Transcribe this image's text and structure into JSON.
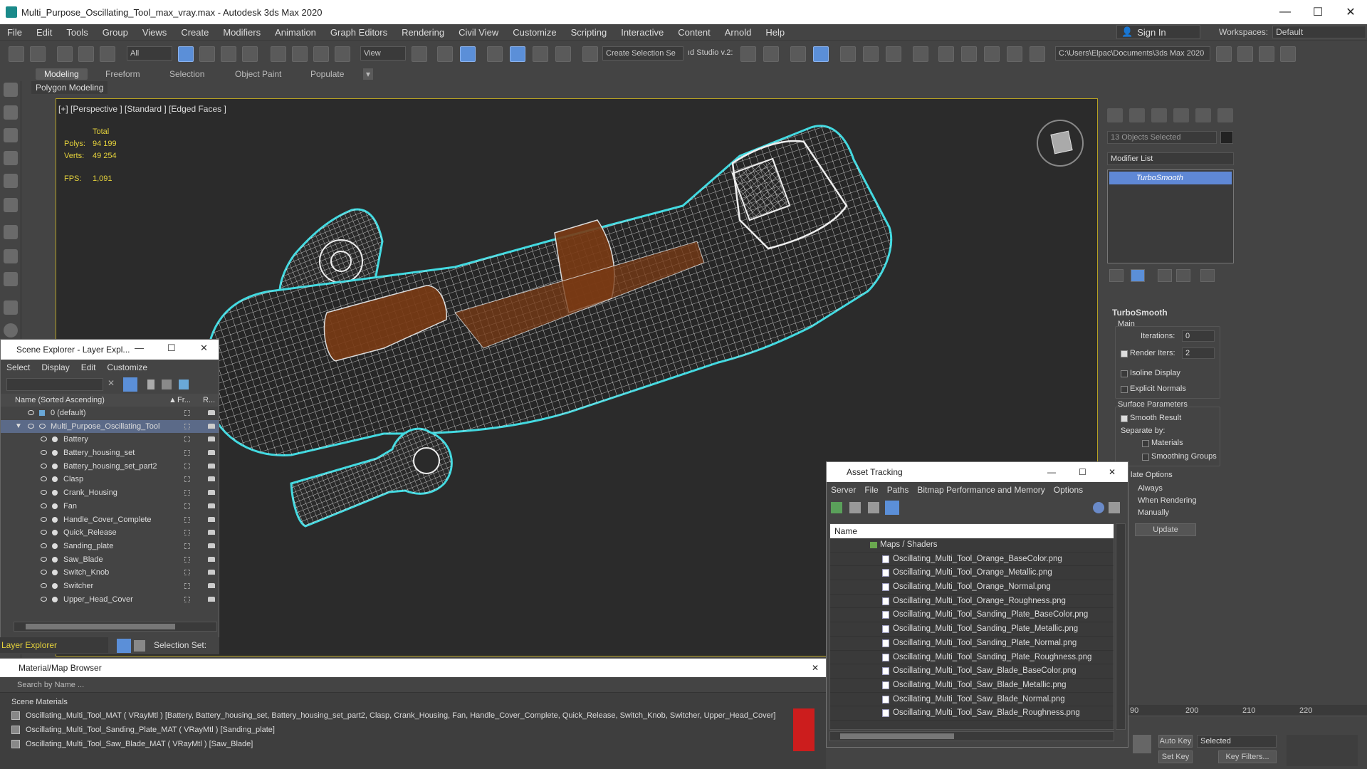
{
  "window": {
    "title": "Multi_Purpose_Oscillating_Tool_max_vray.max - Autodesk 3ds Max 2020",
    "minimize": "—",
    "maximize": "☐",
    "close": "✕"
  },
  "menu": {
    "items": [
      "File",
      "Edit",
      "Tools",
      "Group",
      "Views",
      "Create",
      "Modifiers",
      "Animation",
      "Graph Editors",
      "Rendering",
      "Civil View",
      "Customize",
      "Scripting",
      "Interactive",
      "Content",
      "Arnold",
      "Help"
    ],
    "sign_in": "Sign In",
    "workspaces_label": "Workspaces:",
    "workspaces_value": "Default"
  },
  "toolbar": {
    "filter_all": "All",
    "view_dropdown": "View",
    "create_selection_set": "Create Selection Se",
    "studio_label": "ıd Studio v.2:",
    "project_path": "C:\\Users\\Elpac\\Documents\\3ds Max 2020"
  },
  "ribbon": {
    "tabs": [
      "Modeling",
      "Freeform",
      "Selection",
      "Object Paint",
      "Populate"
    ],
    "sub": "Polygon Modeling"
  },
  "viewport": {
    "label": "[+] [Perspective ] [Standard ] [Edged Faces ]",
    "stats": {
      "total_label": "Total",
      "polys_label": "Polys:",
      "polys_value": "94 199",
      "verts_label": "Verts:",
      "verts_value": "49 254",
      "fps_label": "FPS:",
      "fps_value": "1,091"
    }
  },
  "command_panel": {
    "selection_count": "13 Objects Selected",
    "modifier_list": "Modifier List",
    "modifier": "TurboSmooth",
    "rollout_title": "TurboSmooth",
    "main_label": "Main",
    "iterations_label": "Iterations:",
    "iterations_value": "0",
    "render_iters_label": "Render Iters:",
    "render_iters_value": "2",
    "isoline_display": "Isoline Display",
    "explicit_normals": "Explicit Normals",
    "surface_parameters": "Surface Parameters",
    "smooth_result": "Smooth Result",
    "separate_by": "Separate by:",
    "materials": "Materials",
    "smoothing_groups": "Smoothing Groups",
    "update_options": "late Options",
    "always": "Always",
    "when_rendering": "When Rendering",
    "manually": "Manually",
    "update_button": "Update"
  },
  "scene_explorer": {
    "title": "Scene Explorer - Layer Expl...",
    "menu": [
      "Select",
      "Display",
      "Edit",
      "Customize"
    ],
    "column_name": "Name (Sorted Ascending)",
    "column_freeze": "Fr...",
    "column_render": "R...",
    "rows": [
      {
        "label": "0 (default)",
        "level": 1
      },
      {
        "label": "Multi_Purpose_Oscillating_Tool",
        "level": 1
      },
      {
        "label": "Battery",
        "level": 2
      },
      {
        "label": "Battery_housing_set",
        "level": 2
      },
      {
        "label": "Battery_housing_set_part2",
        "level": 2
      },
      {
        "label": "Clasp",
        "level": 2
      },
      {
        "label": "Crank_Housing",
        "level": 2
      },
      {
        "label": "Fan",
        "level": 2
      },
      {
        "label": "Handle_Cover_Complete",
        "level": 2
      },
      {
        "label": "Quick_Release",
        "level": 2
      },
      {
        "label": "Sanding_plate",
        "level": 2
      },
      {
        "label": "Saw_Blade",
        "level": 2
      },
      {
        "label": "Switch_Knob",
        "level": 2
      },
      {
        "label": "Switcher",
        "level": 2
      },
      {
        "label": "Upper_Head_Cover",
        "level": 2
      }
    ],
    "layer_explorer": "Layer Explorer",
    "selection_set": "Selection Set:"
  },
  "material_browser": {
    "title": "Material/Map Browser",
    "search_placeholder": "Search by Name ...",
    "section": "Scene Materials",
    "rows": [
      "Oscillating_Multi_Tool_MAT ( VRayMtl ) [Battery, Battery_housing_set, Battery_housing_set_part2, Clasp, Crank_Housing, Fan, Handle_Cover_Complete, Quick_Release, Switch_Knob, Switcher, Upper_Head_Cover]",
      "Oscillating_Multi_Tool_Sanding_Plate_MAT ( VRayMtl ) [Sanding_plate]",
      "Oscillating_Multi_Tool_Saw_Blade_MAT ( VRayMtl ) [Saw_Blade]"
    ]
  },
  "asset_tracking": {
    "title": "Asset Tracking",
    "menu": [
      "Server",
      "File",
      "Paths",
      "Bitmap Performance and Memory",
      "Options"
    ],
    "column_name": "Name",
    "group": "Maps / Shaders",
    "files": [
      "Oscillating_Multi_Tool_Orange_BaseColor.png",
      "Oscillating_Multi_Tool_Orange_Metallic.png",
      "Oscillating_Multi_Tool_Orange_Normal.png",
      "Oscillating_Multi_Tool_Orange_Roughness.png",
      "Oscillating_Multi_Tool_Sanding_Plate_BaseColor.png",
      "Oscillating_Multi_Tool_Sanding_Plate_Metallic.png",
      "Oscillating_Multi_Tool_Sanding_Plate_Normal.png",
      "Oscillating_Multi_Tool_Sanding_Plate_Roughness.png",
      "Oscillating_Multi_Tool_Saw_Blade_BaseColor.png",
      "Oscillating_Multi_Tool_Saw_Blade_Metallic.png",
      "Oscillating_Multi_Tool_Saw_Blade_Normal.png",
      "Oscillating_Multi_Tool_Saw_Blade_Roughness.png"
    ]
  },
  "timeline": {
    "ticks": [
      "90",
      "200",
      "210",
      "220"
    ],
    "auto_key": "Auto Key",
    "set_key": "Set Key",
    "selected": "Selected",
    "key_filters": "Key Filters..."
  },
  "colors": {
    "selection_outline": "#41d9e0",
    "accent_blue": "#5b8fd8",
    "body_orange": "#7a3a14",
    "viewport_bg": "#2b2b2b",
    "stats_yellow": "#e6d33c"
  }
}
